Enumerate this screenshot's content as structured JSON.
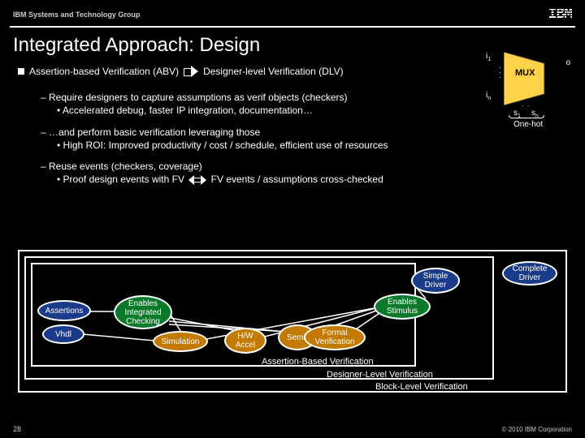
{
  "header": {
    "group": "IBM Systems and Technology Group",
    "logo": "IBM"
  },
  "title": "Integrated Approach: Design",
  "line1": {
    "a": "Assertion-based Verification (ABV)",
    "b": "Designer-level Verification (DLV)"
  },
  "req": {
    "l1": "Require designers to capture assumptions as verif objects (checkers)",
    "l2": "Accelerated debug, faster IP integration, documentation…"
  },
  "perf": {
    "l1": "…and perform basic verification leveraging those",
    "l2": "High ROI: Improved productivity / cost / schedule, efficient use of resources"
  },
  "reuse": {
    "l1": "Reuse events (checkers, coverage)",
    "l2a": "Proof design events with FV",
    "l2b": "FV events / assumptions cross-checked"
  },
  "mux": {
    "label": "MUX",
    "i1": "i",
    "i1s": "1",
    "in": "i",
    "ins": "n",
    "o": "o",
    "s1": "s",
    "s1s": "1",
    "sn": "s",
    "sns": "n",
    "onehot": "One-hot"
  },
  "diagram": {
    "assertions": "Assertions",
    "vhdl": "Vhdl",
    "check": "Enables Integrated Checking",
    "sim": "Simulation",
    "hw": "H/W Accel",
    "semi": "Semi-",
    "formal": "Formal Verification",
    "stim": "Enables Stimulus",
    "simple": "Simple Driver",
    "complete": "Complete Driver",
    "abv": "Assertion-Based Verification",
    "dlv": "Designer-Level Verification",
    "blv": "Block-Level Verification"
  },
  "footer": {
    "page": "28",
    "copyright": "© 2010 IBM Corporation"
  }
}
